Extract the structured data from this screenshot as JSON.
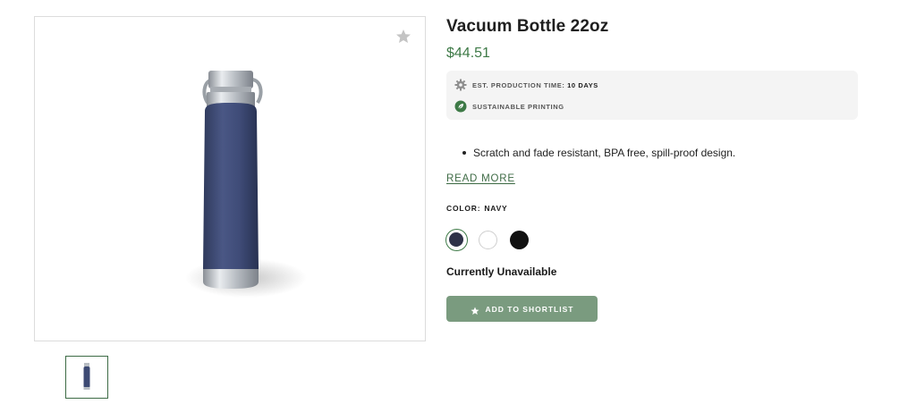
{
  "product": {
    "title": "Vacuum Bottle 22oz",
    "price": "$44.51"
  },
  "info": {
    "production_label": "EST. PRODUCTION TIME:",
    "production_value": "10 DAYS",
    "production_icon": "gear-icon",
    "sustainable_label": "SUSTAINABLE PRINTING",
    "sustainable_icon": "leaf-icon"
  },
  "description": {
    "bullets": [
      "Scratch and fade resistant, BPA free, spill-proof design."
    ],
    "read_more": "READ MORE"
  },
  "color": {
    "label": "COLOR:",
    "selected": "NAVY",
    "options": [
      {
        "name": "navy",
        "hex": "#2e3248",
        "selected": true
      },
      {
        "name": "white",
        "hex": "#ffffff",
        "selected": false
      },
      {
        "name": "black",
        "hex": "#111111",
        "selected": false
      }
    ]
  },
  "availability": "Currently Unavailable",
  "actions": {
    "shortlist_label": "ADD TO SHORTLIST",
    "shortlist_icon": "star-icon"
  },
  "gallery": {
    "favorite_icon": "star-icon",
    "thumbnails": 1
  },
  "colors": {
    "accent": "#3e7a47",
    "button_bg": "#7a9b7f",
    "info_bg": "#f4f4f4",
    "bottle_body": "#3d4a73"
  }
}
